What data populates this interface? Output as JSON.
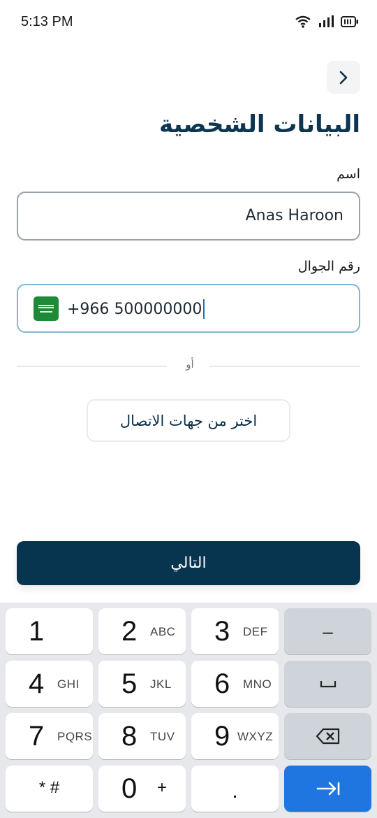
{
  "status_bar": {
    "time": "5:13 PM"
  },
  "header": {
    "title": "البيانات الشخصية"
  },
  "form": {
    "name_label": "اسم",
    "name_value": "Anas Haroon",
    "phone_label": "رقم الجوال",
    "country_code": "+966",
    "phone_value": "500000000"
  },
  "divider": {
    "text": "أو"
  },
  "contacts_button": {
    "label": "اختر من جهات الاتصال"
  },
  "next_button": {
    "label": "التالي"
  },
  "keyboard": {
    "keys": [
      {
        "num": "1",
        "letters": ""
      },
      {
        "num": "2",
        "letters": "ABC"
      },
      {
        "num": "3",
        "letters": "DEF"
      },
      {
        "num": "4",
        "letters": "GHI"
      },
      {
        "num": "5",
        "letters": "JKL"
      },
      {
        "num": "6",
        "letters": "MNO"
      },
      {
        "num": "7",
        "letters": "PQRS"
      },
      {
        "num": "8",
        "letters": "TUV"
      },
      {
        "num": "9",
        "letters": "WXYZ"
      },
      {
        "num": "0",
        "letters": "+"
      }
    ],
    "star_hash": "* #",
    "period": ".",
    "minus": "–"
  },
  "colors": {
    "primary": "#07344f",
    "accent": "#1f76e0",
    "input_focus": "#7fb6d3"
  }
}
